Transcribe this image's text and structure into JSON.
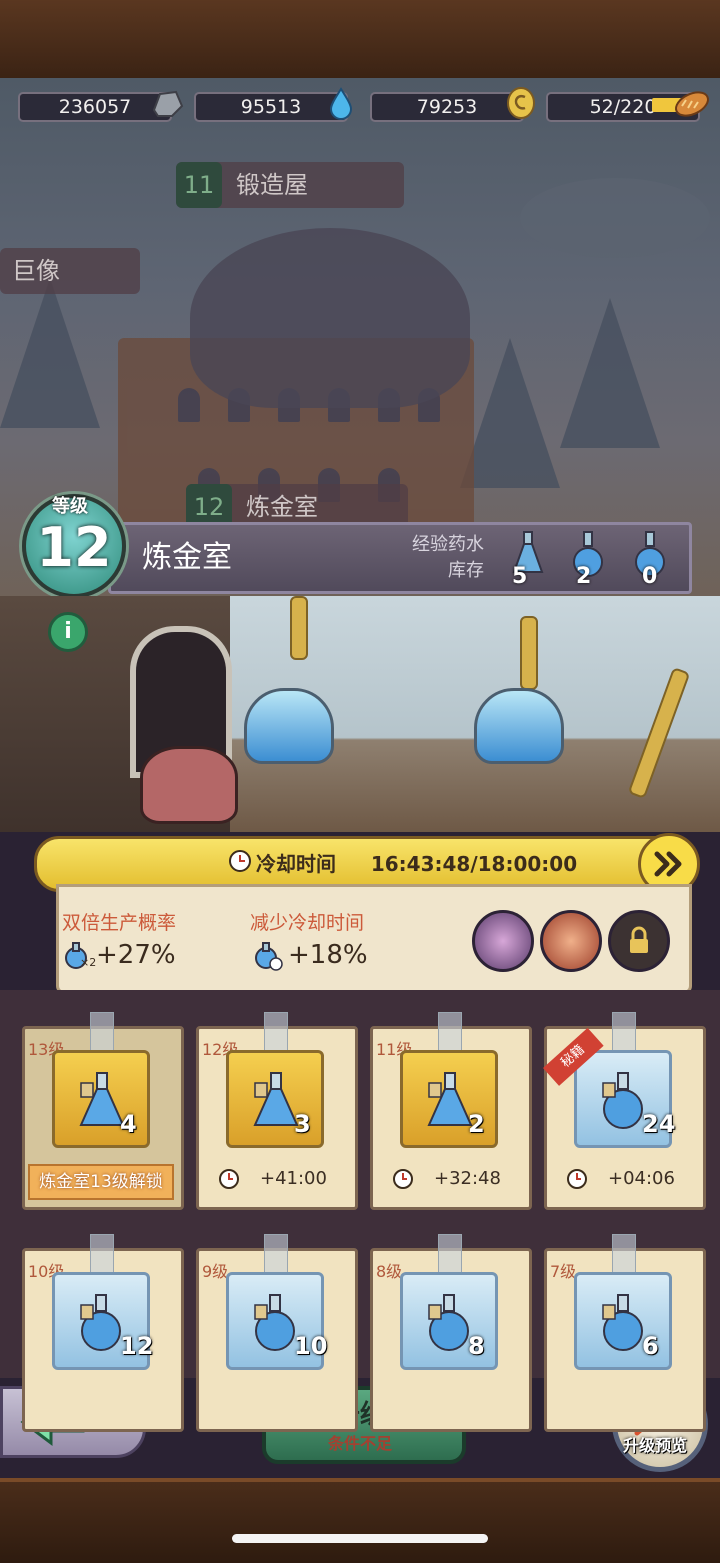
{
  "resources": [
    {
      "value": "236057",
      "icon": "ore-icon"
    },
    {
      "value": "95513",
      "icon": "water-drop-icon"
    },
    {
      "value": "79253",
      "icon": "gold-coin-icon"
    },
    {
      "value": "52/220",
      "icon": "bread-icon"
    }
  ],
  "scene": {
    "sign_forge_num": "11",
    "sign_forge": "锻造屋",
    "sign_statue": "巨像",
    "sign_alchemy_num": "12",
    "sign_alchemy": "炼金室"
  },
  "header": {
    "level_label": "等级",
    "level": "12",
    "room_title": "炼金室",
    "stock_label_1": "经验药水",
    "stock_label_2": "库存",
    "stock": [
      "5",
      "2",
      "0"
    ]
  },
  "cooldown": {
    "label": "冷却时间",
    "value": "16:43:48/18:00:00"
  },
  "stats": {
    "double_label": "双倍生产概率",
    "double_value": "+27%",
    "double_icon_multiplier": "×2",
    "reduce_label": "减少冷却时间",
    "reduce_value": "+18%"
  },
  "cards": [
    {
      "level": "13级",
      "count": "4",
      "tier": "gold",
      "locked": true,
      "unlock": "炼金室13级解锁"
    },
    {
      "level": "12级",
      "count": "3",
      "tier": "gold",
      "time": "+41:00"
    },
    {
      "level": "11级",
      "count": "2",
      "tier": "gold",
      "time": "+32:48"
    },
    {
      "level": "",
      "count": "24",
      "tier": "blue",
      "time": "+04:06",
      "ribbon": "秘籍"
    },
    {
      "level": "10级",
      "count": "12",
      "tier": "blue"
    },
    {
      "level": "9级",
      "count": "10",
      "tier": "blue"
    },
    {
      "level": "8级",
      "count": "8",
      "tier": "blue"
    },
    {
      "level": "7级",
      "count": "6",
      "tier": "blue"
    }
  ],
  "footer": {
    "upgrade": "升级",
    "upgrade_sub": "条件不足",
    "preview": "升级预览"
  },
  "colors": {
    "accent_yellow": "#f8dc48",
    "upgrade_green": "#3f8c66",
    "warning_red": "#cc5a3a"
  }
}
